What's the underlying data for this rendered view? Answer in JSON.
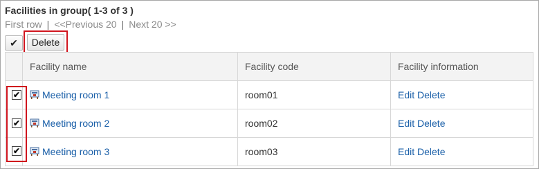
{
  "header": {
    "title": "Facilities in group( 1-3 of 3 )"
  },
  "pager": {
    "first": "First row",
    "separator": "|",
    "previous": "<<Previous 20",
    "next": "Next 20 >>"
  },
  "toolbar": {
    "check_all_glyph": "✔",
    "delete_label": "Delete"
  },
  "table": {
    "columns": [
      "Facility name",
      "Facility code",
      "Facility information"
    ],
    "rows": [
      {
        "name": "Meeting room 1",
        "code": "room01",
        "edit": "Edit",
        "delete": "Delete",
        "checked": true
      },
      {
        "name": "Meeting room 2",
        "code": "room02",
        "edit": "Edit",
        "delete": "Delete",
        "checked": true
      },
      {
        "name": "Meeting room 3",
        "code": "room03",
        "edit": "Edit",
        "delete": "Delete",
        "checked": true
      }
    ]
  },
  "colors": {
    "link": "#1a5fa8",
    "highlight": "#d0141d",
    "header_bg": "#f3f3f3"
  },
  "icons": {
    "facility": "facility-icon",
    "checkmark": "checkmark-icon"
  },
  "checkbox_glyph": "✔"
}
